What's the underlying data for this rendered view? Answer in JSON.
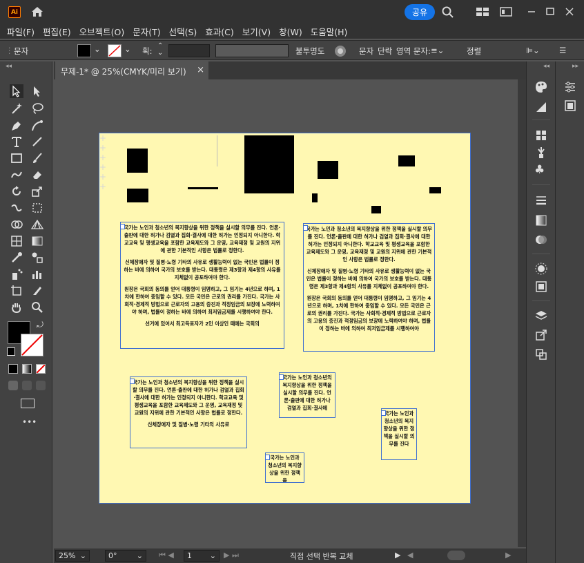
{
  "app": {
    "logo": "Ai",
    "share_label": "공유"
  },
  "menu": [
    "파일(F)",
    "편집(E)",
    "오브젝트(O)",
    "문자(T)",
    "선택(S)",
    "효과(C)",
    "보기(V)",
    "창(W)",
    "도움말(H)"
  ],
  "control_bar": {
    "selection_label": "문자",
    "stroke_label": "획:",
    "opacity_label": "불투명도",
    "char_label": "문자",
    "para_label": "단락",
    "area_type_label": "영역 문자:",
    "align_label": "정렬"
  },
  "document_tab": {
    "title": "무제-1* @ 25%(CMYK/미리 보기)",
    "close": "×"
  },
  "text_frames": {
    "f1": {
      "paragraphs": [
        "국가는 노인과 청소년의 복지향상을 위한 정책을 실시할 의무를 진다. 언론·출판에 대한 허가나 검열과 집회·결사에 대한 허가는 인정되지 아니한다. 학교교육 및 평생교육을 포함한 교육제도와 그 운영, 교육재정 및 교원의 지위에 관한 기본적인 사항은 법률로 정한다.",
        "신체장애자 및 질병·노령 기타의 사유로 생활능력이 없는 국민은 법률이 정하는 바에 의하여 국가의 보호를 받는다. 대통령은 제3항과 제4항의 사유를 지체없이 공포하여야 한다.",
        "원장은 국회의 동의를 얻어 대통령이 임명하고, 그 임기는 4년으로 하며, 1차에 한하여 중임할 수 있다. 모든 국민은 근로의 권리를 가진다. 국가는 사회적·경제적 방법으로 근로자의 고용의 증진과 적정임금의 보장에 노력하여야 하며, 법률이 정하는 바에 의하여 최저임금제를 시행하여야 한다.",
        "선거에 있어서 최고득표자가 2인 이상인 때에는 국회의"
      ]
    },
    "f2": {
      "paragraphs": [
        "국가는 노인과 청소년의 복지향상을 위한 정책을 실시할 의무를 진다. 언론·출판에 대한 허가나 검열과 집회·결사에 대한 허가는 인정되지 아니한다. 학교교육 및 평생교육을 포함한 교육제도와 그 운영, 교육재정 및 교원의 지위에 관한 기본적인 사항은 법률로 정한다.",
        "신체장애자 및 질병·노령 기타의 사유로 생활능력이 없는 국민은 법률이 정하는 바에 의하여 국가의 보호를 받는다. 대통령은 제3항과 제4항의 사유를 지체없이 공포하여야 한다.",
        "원장은 국회의 동의를 얻어 대통령이 임명하고, 그 임기는 4년으로 하며, 1차에 한하여 중임할 수 있다. 모든 국민은 근로의 권리를 가진다. 국가는 사회적·경제적 방법으로 근로자의 고용의 증진과 적정임금의 보장에 노력하여야 하며, 법률이 정하는 바에 의하여 최저임금제를 시행하여야"
      ]
    },
    "f3": {
      "paragraphs": [
        "국가는 노인과 청소년의 복지향상을 위한 정책을 실시할 의무를 진다. 언론·출판에 대한 허가나 검열과 집회·결사에 대한 허가는 인정되지 아니한다. 학교교육 및 평생교육을 포함한 교육제도와 그 운영, 교육재정 및 교원의 지위에 관한 기본적인 사항은 법률로 정한다.",
        "신체장애자 및 질병·노령 기타의 사유로"
      ]
    },
    "f4": {
      "paragraphs": [
        "국가는 노인과 청소년의 복지향상을 위한 정책을 실시할 의무를 진다. 언론·출판에 대한 허가나 검열과 집회·결사에"
      ]
    },
    "f5": {
      "paragraphs": [
        "국가는 노인과 청소년의 복지향상을 위한 정책을 실시할 의무를 진다"
      ]
    },
    "f6": {
      "paragraphs": [
        "국가는 노인과 청소년의 복지향상을 위한 정책을"
      ]
    }
  },
  "status_bar": {
    "zoom": "25%",
    "rotation": "0°",
    "artboard_num": "1",
    "tool_status": "직접 선택 반복 교체"
  },
  "colors": {
    "artboard_bg": "#fff8b2",
    "selection": "#3f6fd0",
    "accent": "#1473e6"
  }
}
